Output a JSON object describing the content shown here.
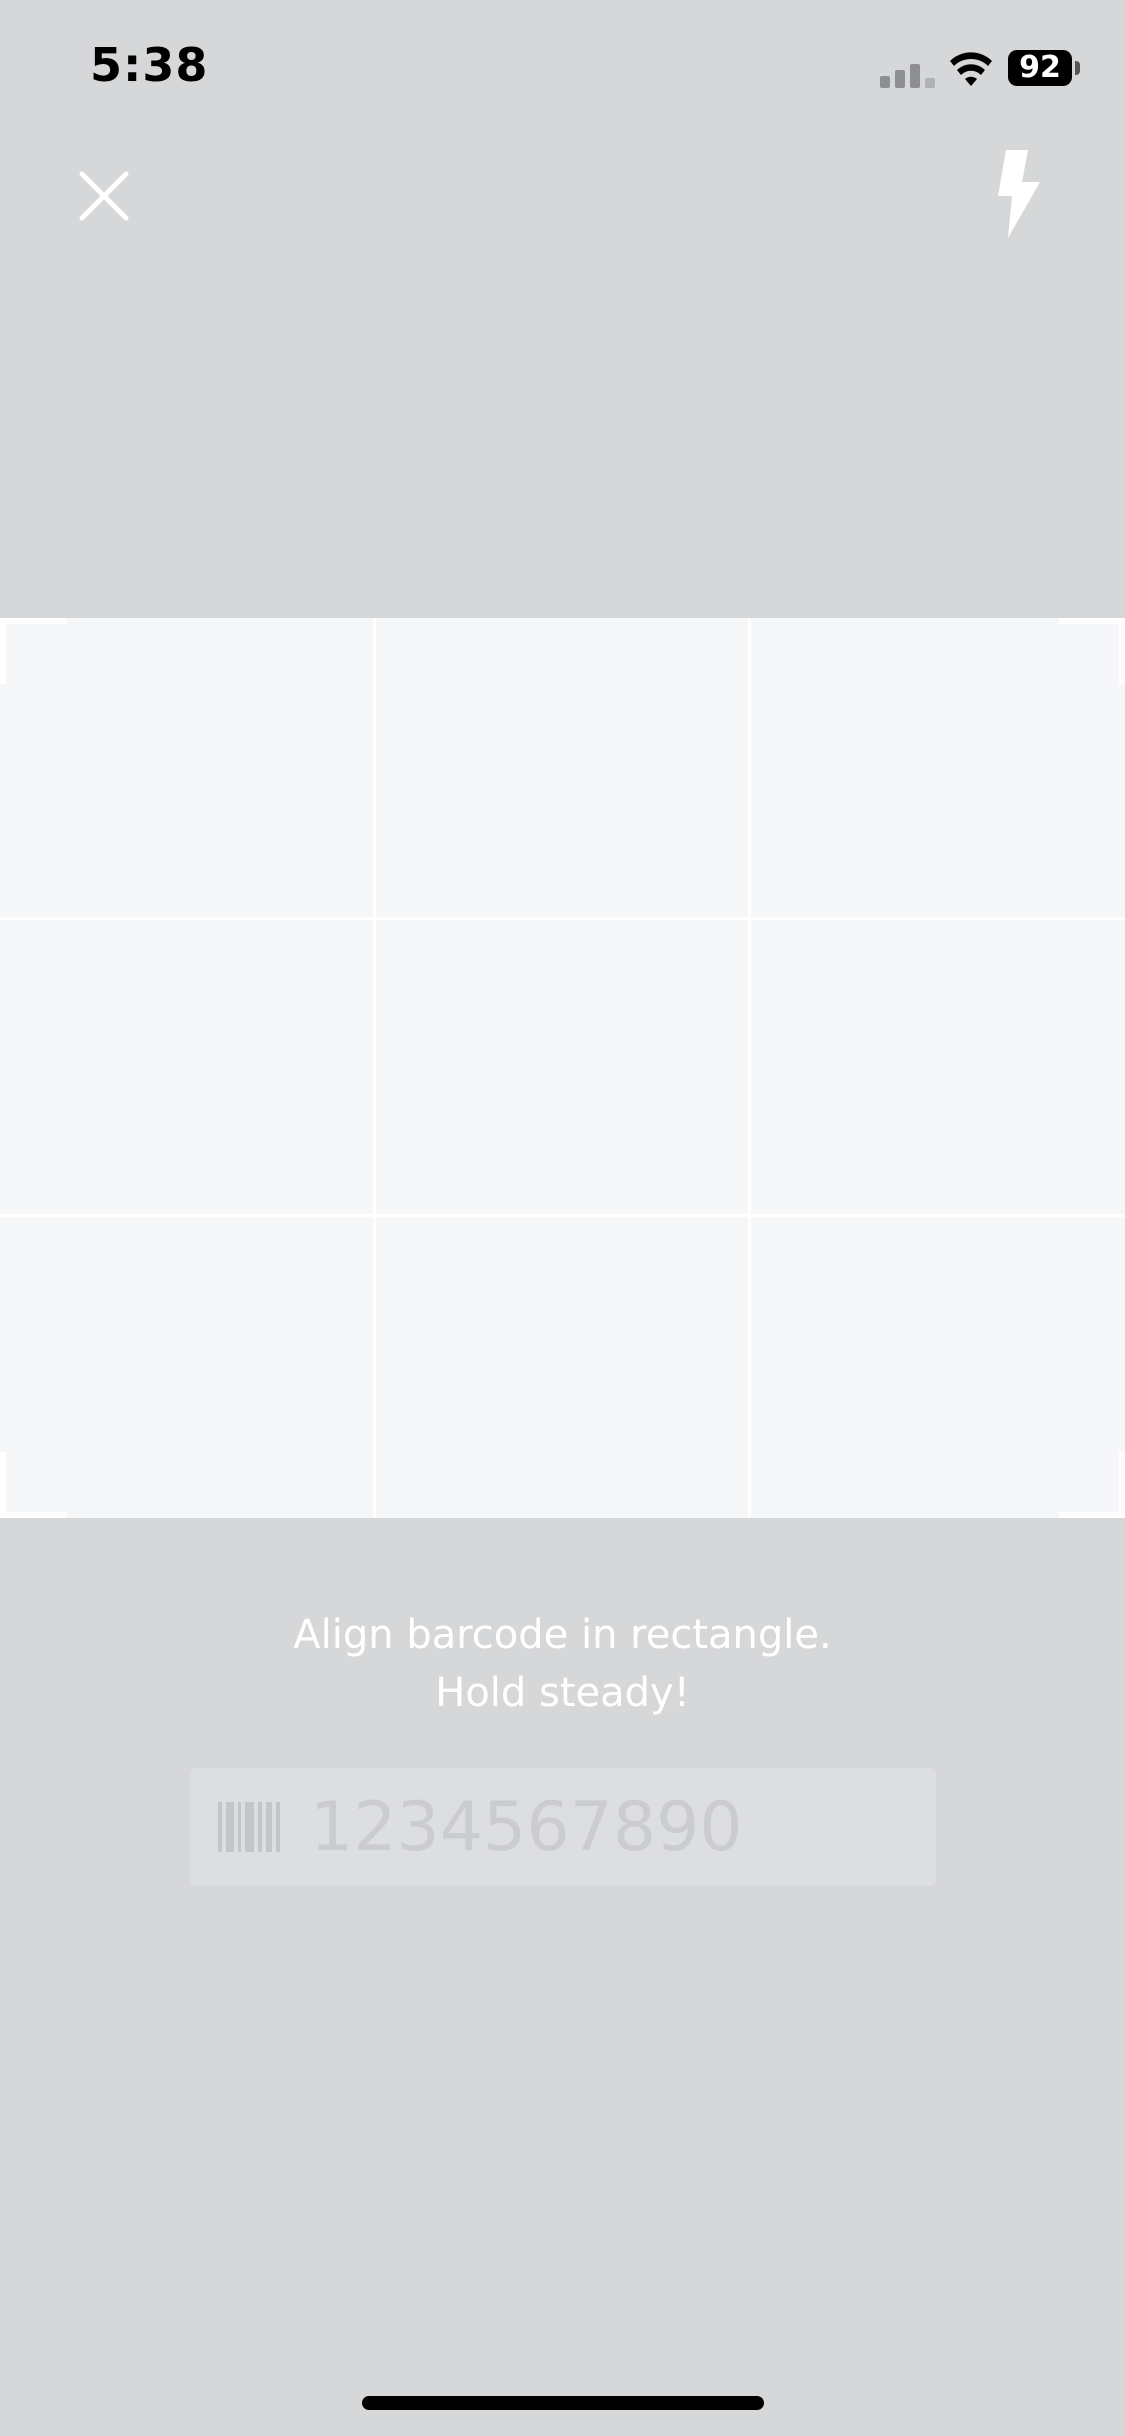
{
  "status_bar": {
    "time": "5:38",
    "battery_level": "92"
  },
  "toolbar": {
    "close_icon": "close-icon",
    "flash_icon": "flash-icon"
  },
  "scanner": {
    "instruction_line1": "Align barcode in rectangle.",
    "instruction_line2": "Hold steady!"
  },
  "manual_entry": {
    "icon": "barcode-icon",
    "placeholder": "1234567890",
    "value": ""
  },
  "colors": {
    "background": "#d6d7d9",
    "scan_area": "#f6f7f9",
    "text_light": "#ffffff"
  }
}
